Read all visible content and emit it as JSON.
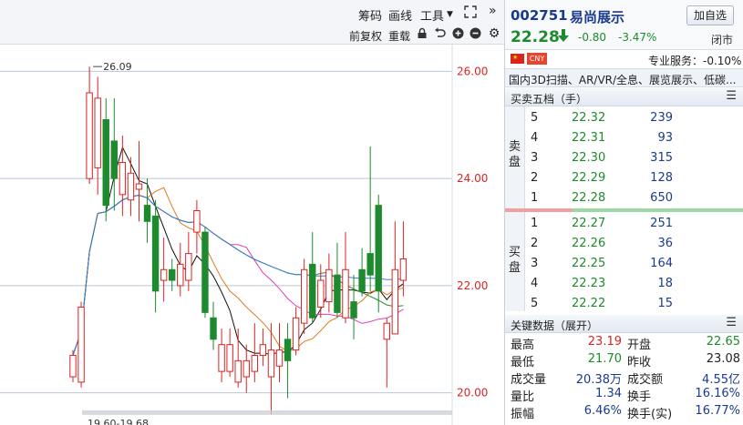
{
  "toolbar": {
    "chips": "筹码",
    "draw": "画线",
    "tools": "工具",
    "restore": "前复权",
    "restore2": "重载"
  },
  "chart_data": {
    "type": "candlestick",
    "price_axis": {
      "ylim": [
        19.4,
        26.5
      ],
      "ticks": [
        "26.00",
        "24.00",
        "22.00",
        "20.00"
      ]
    },
    "annotations": {
      "high": "26.09",
      "low_range": "19.60-19.68"
    },
    "candles": [
      {
        "o": 20.3,
        "c": 20.7,
        "h": 20.8,
        "l": 20.2
      },
      {
        "o": 20.2,
        "c": 21.6,
        "h": 21.7,
        "l": 20.1
      },
      {
        "o": 24.0,
        "c": 25.6,
        "h": 26.09,
        "l": 23.9
      },
      {
        "o": 24.2,
        "c": 25.5,
        "h": 25.9,
        "l": 23.7
      },
      {
        "o": 25.1,
        "c": 23.5,
        "h": 25.5,
        "l": 23.2
      },
      {
        "o": 24.7,
        "c": 24.0,
        "h": 25.5,
        "l": 23.4
      },
      {
        "o": 23.7,
        "c": 24.3,
        "h": 24.8,
        "l": 23.3
      },
      {
        "o": 23.6,
        "c": 24.1,
        "h": 24.4,
        "l": 23.3
      },
      {
        "o": 23.8,
        "c": 23.9,
        "h": 24.7,
        "l": 23.2
      },
      {
        "o": 23.5,
        "c": 23.2,
        "h": 24.0,
        "l": 22.8
      },
      {
        "o": 23.3,
        "c": 21.9,
        "h": 23.6,
        "l": 21.5
      },
      {
        "o": 22.1,
        "c": 22.3,
        "h": 22.9,
        "l": 21.7
      },
      {
        "o": 22.3,
        "c": 22.1,
        "h": 22.5,
        "l": 21.9
      },
      {
        "o": 22.0,
        "c": 22.4,
        "h": 22.8,
        "l": 21.8
      },
      {
        "o": 22.1,
        "c": 22.6,
        "h": 23.0,
        "l": 21.9
      },
      {
        "o": 23.0,
        "c": 23.4,
        "h": 23.6,
        "l": 22.6
      },
      {
        "o": 23.0,
        "c": 21.5,
        "h": 23.1,
        "l": 21.4
      },
      {
        "o": 21.4,
        "c": 21.0,
        "h": 21.7,
        "l": 20.8
      },
      {
        "o": 20.4,
        "c": 20.9,
        "h": 21.2,
        "l": 20.2
      },
      {
        "o": 20.4,
        "c": 20.9,
        "h": 21.2,
        "l": 20.3
      },
      {
        "o": 20.2,
        "c": 20.6,
        "h": 21.2,
        "l": 20.1
      },
      {
        "o": 20.3,
        "c": 20.6,
        "h": 20.9,
        "l": 20.0
      },
      {
        "o": 20.4,
        "c": 20.7,
        "h": 21.3,
        "l": 20.2
      },
      {
        "o": 20.7,
        "c": 20.9,
        "h": 21.2,
        "l": 20.5
      },
      {
        "o": 20.3,
        "c": 20.8,
        "h": 21.3,
        "l": 19.6
      },
      {
        "o": 20.5,
        "c": 20.8,
        "h": 21.3,
        "l": 20.2
      },
      {
        "o": 21.0,
        "c": 20.6,
        "h": 21.3,
        "l": 19.9
      },
      {
        "o": 20.8,
        "c": 21.4,
        "h": 21.6,
        "l": 20.7
      },
      {
        "o": 21.3,
        "c": 22.3,
        "h": 22.5,
        "l": 21.1
      },
      {
        "o": 22.4,
        "c": 21.4,
        "h": 23.0,
        "l": 21.3
      },
      {
        "o": 21.6,
        "c": 22.1,
        "h": 22.4,
        "l": 21.4
      },
      {
        "o": 21.7,
        "c": 22.3,
        "h": 22.6,
        "l": 21.5
      },
      {
        "o": 22.2,
        "c": 21.5,
        "h": 22.8,
        "l": 21.4
      },
      {
        "o": 21.4,
        "c": 22.3,
        "h": 23.0,
        "l": 21.3
      },
      {
        "o": 21.7,
        "c": 21.4,
        "h": 22.2,
        "l": 21.0
      },
      {
        "o": 22.3,
        "c": 21.9,
        "h": 22.7,
        "l": 21.8
      },
      {
        "o": 22.6,
        "c": 22.2,
        "h": 24.6,
        "l": 21.9
      },
      {
        "o": 23.5,
        "c": 21.9,
        "h": 23.7,
        "l": 21.5
      },
      {
        "o": 21.0,
        "c": 21.3,
        "h": 21.4,
        "l": 20.1
      },
      {
        "o": 21.1,
        "c": 22.3,
        "h": 23.2,
        "l": 21.1
      },
      {
        "o": 22.1,
        "c": 22.5,
        "h": 23.2,
        "l": 21.8
      }
    ]
  },
  "quote": {
    "code": "002751",
    "name": "易尚展示",
    "add_watch": "加自选",
    "last": "22.28",
    "arrow": "🡇",
    "change": "-0.80",
    "change_pct": "-3.47%",
    "status": "闭市",
    "badge": "CNY",
    "pro_service": "专业服务：-0.10%",
    "concepts": "国内3D扫描、AR/VR/全息、展览展示、低碳..."
  },
  "book": {
    "title": "买卖五档（手）",
    "ask_label": [
      "卖",
      "盘"
    ],
    "bid_label": [
      "买",
      "盘"
    ],
    "asks": [
      {
        "lvl": "5",
        "px": "22.32",
        "vol": "239"
      },
      {
        "lvl": "4",
        "px": "22.31",
        "vol": "93"
      },
      {
        "lvl": "3",
        "px": "22.30",
        "vol": "315"
      },
      {
        "lvl": "2",
        "px": "22.29",
        "vol": "128"
      },
      {
        "lvl": "1",
        "px": "22.28",
        "vol": "650"
      }
    ],
    "bids": [
      {
        "lvl": "1",
        "px": "22.27",
        "vol": "251"
      },
      {
        "lvl": "2",
        "px": "22.26",
        "vol": "36"
      },
      {
        "lvl": "3",
        "px": "22.25",
        "vol": "164"
      },
      {
        "lvl": "4",
        "px": "22.23",
        "vol": "18"
      },
      {
        "lvl": "5",
        "px": "22.22",
        "vol": "15"
      }
    ]
  },
  "key_data": {
    "title": "关键数据（展开）",
    "rows": [
      {
        "l1": "最高",
        "v1": "23.19",
        "c1": "red",
        "l2": "开盘",
        "v2": "22.65",
        "c2": "green"
      },
      {
        "l1": "最低",
        "v1": "21.70",
        "c1": "green",
        "l2": "昨收",
        "v2": "23.08",
        "c2": "dark"
      },
      {
        "l1": "成交量",
        "v1": "20.38万",
        "c1": "blue",
        "l2": "成交额",
        "v2": "4.55亿",
        "c2": "blue"
      },
      {
        "l1": "量比",
        "v1": "1.34",
        "c1": "blue",
        "l2": "换手",
        "v2": "16.16%",
        "c2": "blue"
      },
      {
        "l1": "振幅",
        "v1": "6.46%",
        "c1": "blue",
        "l2": "换手(实)",
        "v2": "16.77%",
        "c2": "blue"
      }
    ]
  },
  "colors": {
    "up": "#d22",
    "down": "#1e8a2e",
    "accent": "#1a3a8a"
  }
}
